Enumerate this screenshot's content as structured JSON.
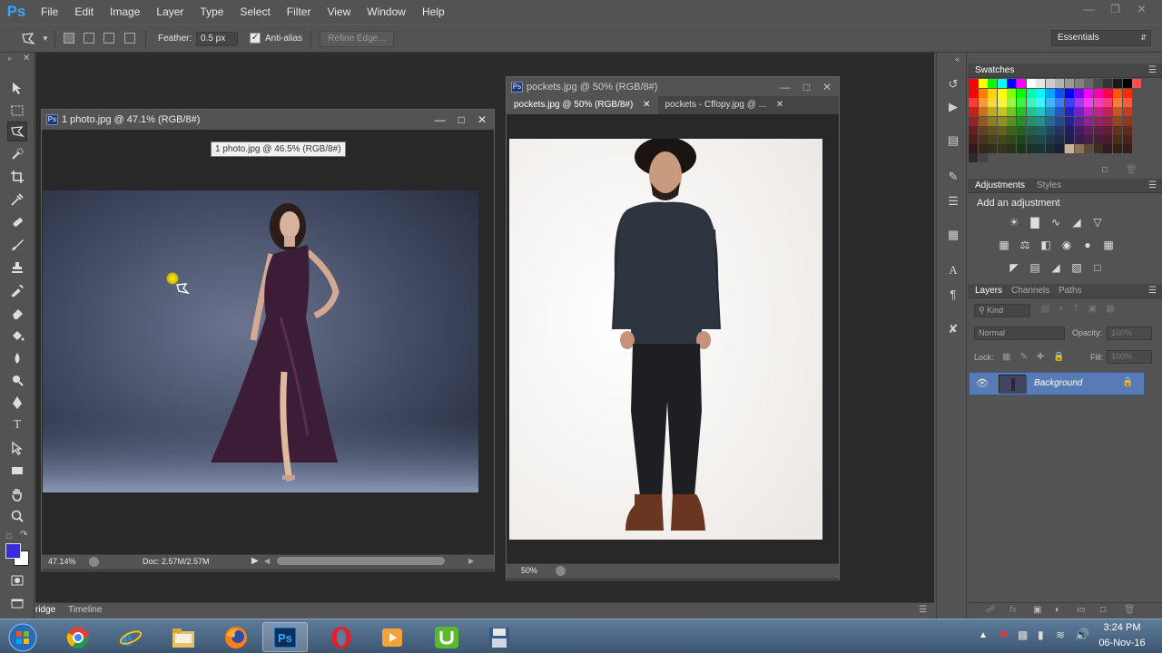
{
  "app": {
    "logo": "Ps",
    "menu": [
      "File",
      "Edit",
      "Image",
      "Layer",
      "Type",
      "Select",
      "Filter",
      "View",
      "Window",
      "Help"
    ]
  },
  "options": {
    "feather_label": "Feather:",
    "feather_value": "0.5 px",
    "antialias_label": "Anti-alias",
    "antialias_checked": true,
    "refine_edge_label": "Refine Edge...",
    "workspace": "Essentials"
  },
  "doc1": {
    "title": "1 photo.jpg @ 47.1% (RGB/8#)",
    "tooltip": "1 photo.jpg @ 46.5% (RGB/8#)",
    "zoom": "47.14%",
    "doc_info": "Doc: 2.57M/2.57M"
  },
  "doc2": {
    "title": "pockets.jpg @ 50% (RGB/8#)",
    "tabs": [
      "pockets.jpg @ 50% (RGB/8#)",
      "pockets - Cffopy.jpg @ ..."
    ],
    "zoom": "50%"
  },
  "timeline": {
    "tabs": [
      "ridge",
      "Timeline"
    ]
  },
  "panels": {
    "swatches_title": "Swatches",
    "adjustments_tabs": [
      "Adjustments",
      "Styles"
    ],
    "add_adjustment": "Add an adjustment",
    "layers_tabs": [
      "Layers",
      "Channels",
      "Paths"
    ],
    "kind": "Kind",
    "blend_mode": "Normal",
    "opacity_label": "Opacity:",
    "opacity_value": "100%",
    "lock_label": "Lock:",
    "fill_label": "Fill:",
    "fill_value": "100%",
    "layer_name": "Background"
  },
  "colors": {
    "foreground": "#3b2be0",
    "background": "#ffffff",
    "accent": "#31a8ff",
    "layer_selected": "#597bb5"
  },
  "taskbar": {
    "apps": [
      "start-orb",
      "chrome",
      "internet-explorer",
      "file-explorer",
      "firefox",
      "photoshop",
      "opera",
      "media-player",
      "utorrent",
      "floppy-app"
    ],
    "active_app": "photoshop",
    "time": "3:24 PM",
    "date": "06-Nov-16"
  }
}
